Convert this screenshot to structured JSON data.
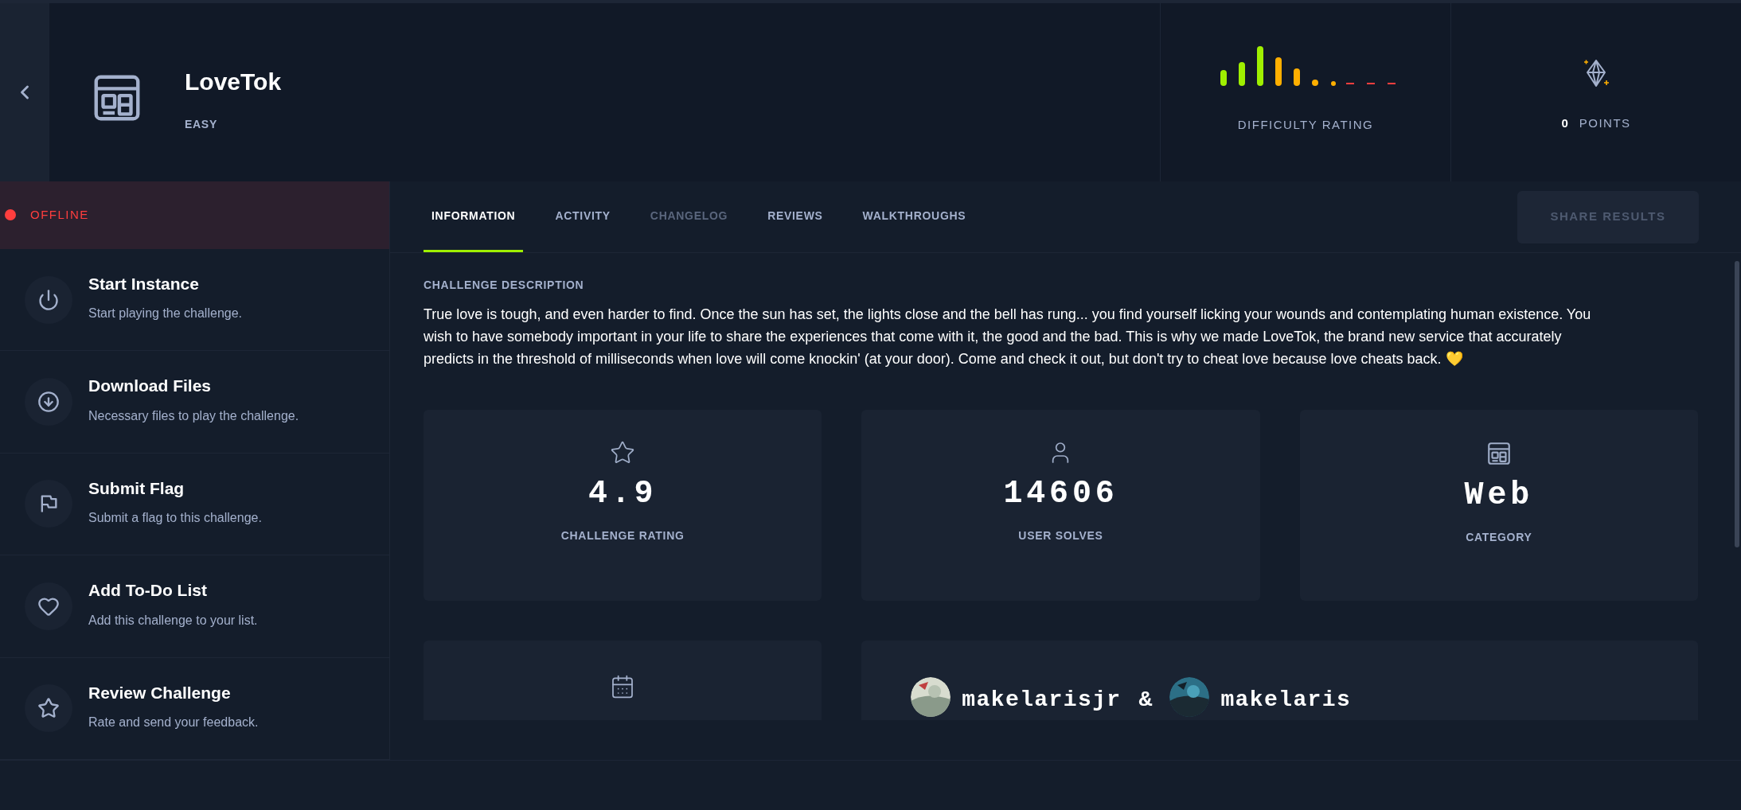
{
  "challenge": {
    "title": "LoveTok",
    "difficulty": "EASY"
  },
  "difficulty_rating": {
    "label": "DIFFICULTY RATING"
  },
  "points": {
    "value": "0",
    "label": "POINTS"
  },
  "status": {
    "label": "OFFLINE",
    "online": false
  },
  "actions": [
    {
      "title": "Start Instance",
      "subtitle": "Start playing the challenge."
    },
    {
      "title": "Download Files",
      "subtitle": "Necessary files to play the challenge."
    },
    {
      "title": "Submit Flag",
      "subtitle": "Submit a flag to this challenge."
    },
    {
      "title": "Add To-Do List",
      "subtitle": "Add this challenge to your list."
    },
    {
      "title": "Review Challenge",
      "subtitle": "Rate and send your feedback."
    }
  ],
  "tabs": [
    {
      "label": "INFORMATION",
      "selected": true,
      "disabled": false
    },
    {
      "label": "ACTIVITY",
      "selected": false,
      "disabled": false
    },
    {
      "label": "CHANGELOG",
      "selected": false,
      "disabled": true
    },
    {
      "label": "REVIEWS",
      "selected": false,
      "disabled": false
    },
    {
      "label": "WALKTHROUGHS",
      "selected": false,
      "disabled": false
    }
  ],
  "share_button": {
    "label": "SHARE RESULTS",
    "disabled": true
  },
  "description": {
    "heading": "CHALLENGE DESCRIPTION",
    "text": "True love is tough, and even harder to find. Once the sun has set, the lights close and the bell has rung... you find yourself licking your wounds and contemplating human existence. You wish to have somebody important in your life to share the experiences that come with it, the good and the bad. This is why we made LoveTok, the brand new service that accurately predicts in the threshold of milliseconds when love will come knockin' (at your door). Come and check it out, but don't try to cheat love because love cheats back. 💛"
  },
  "stats": [
    {
      "value": "4.9",
      "label": "CHALLENGE RATING"
    },
    {
      "value": "14606",
      "label": "USER SOLVES"
    },
    {
      "value": "Web",
      "label": "CATEGORY"
    }
  ],
  "authors": {
    "names": [
      "makelarisjr",
      "makelaris"
    ],
    "separator": "&"
  }
}
